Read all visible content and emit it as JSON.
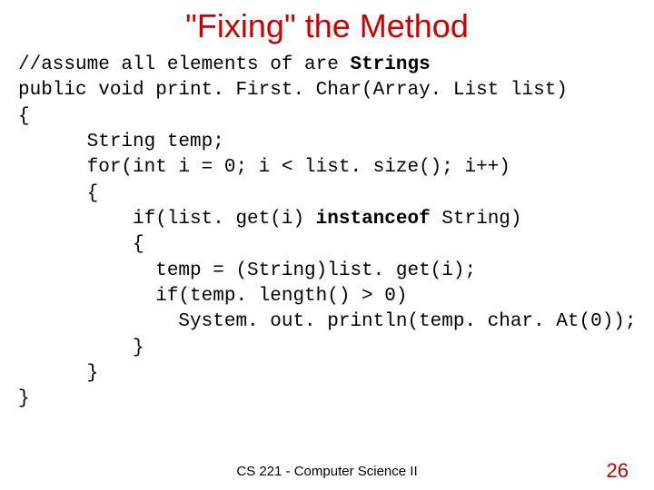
{
  "title": "\"Fixing\" the Method",
  "code": {
    "l01a": "//assume all elements of are ",
    "l01b": "Strings",
    "l02": "public void print. First. Char(Array. List list)",
    "l03": "{",
    "l04": "      String temp;",
    "l05": "      for(int i = 0; i < list. size(); i++)",
    "l06": "      {",
    "l07a": "          if(list. get(i) ",
    "l07b": "instanceof",
    "l07c": " String)",
    "l08": "          {",
    "l09": "            temp = (String)list. get(i);",
    "l10": "            if(temp. length() > 0)",
    "l11": "              System. out. println(temp. char. At(0));",
    "l12": "          }",
    "l13": "      }",
    "l14": "}"
  },
  "footer": {
    "course": "CS 221 - Computer Science II",
    "page": "26"
  }
}
